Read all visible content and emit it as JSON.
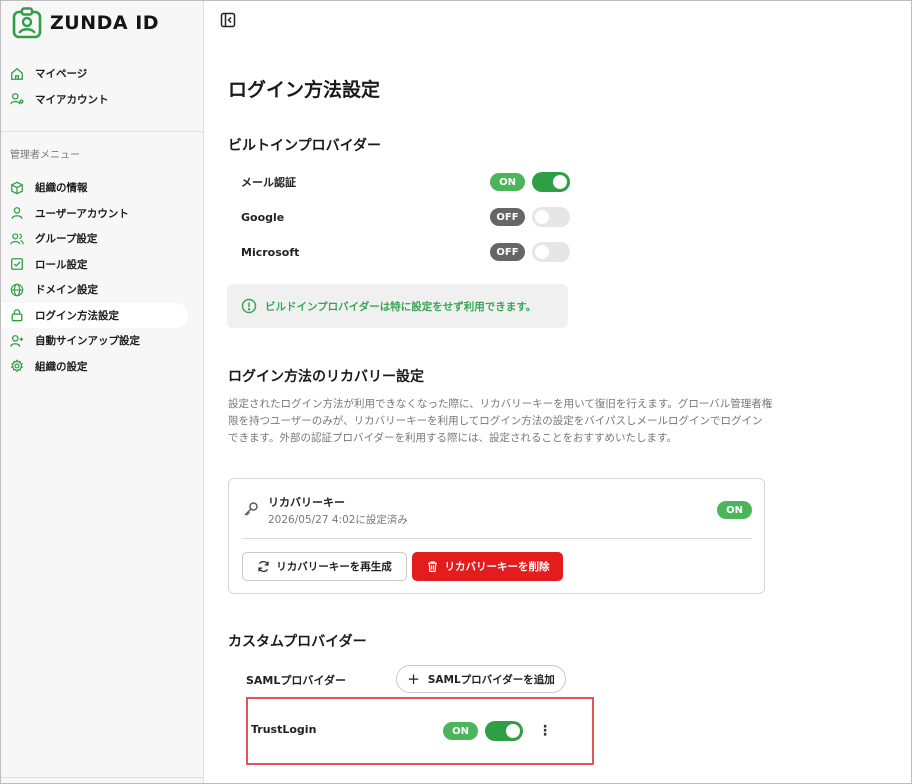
{
  "app": {
    "logo_text": "ZUNDA ID",
    "brand_color": "#2f9e44"
  },
  "sidebar": {
    "top_items": [
      {
        "label": "マイページ",
        "icon": "home-icon"
      },
      {
        "label": "マイアカウント",
        "icon": "user-settings-icon"
      }
    ],
    "section_label": "管理者メニュー",
    "admin_items": [
      {
        "label": "組織の情報",
        "icon": "box-icon"
      },
      {
        "label": "ユーザーアカウント",
        "icon": "user-icon"
      },
      {
        "label": "グループ設定",
        "icon": "users-icon"
      },
      {
        "label": "ロール設定",
        "icon": "checkbox-icon"
      },
      {
        "label": "ドメイン設定",
        "icon": "globe-icon"
      },
      {
        "label": "ログイン方法設定",
        "icon": "lock-icon",
        "active": true
      },
      {
        "label": "自動サインアップ設定",
        "icon": "user-plus-icon"
      },
      {
        "label": "組織の設定",
        "icon": "gear-icon"
      }
    ]
  },
  "main": {
    "title": "ログイン方法設定",
    "builtin": {
      "heading": "ビルトインプロバイダー",
      "providers": [
        {
          "name": "メール認証",
          "status": "ON",
          "enabled": true
        },
        {
          "name": "Google",
          "status": "OFF",
          "enabled": false
        },
        {
          "name": "Microsoft",
          "status": "OFF",
          "enabled": false
        }
      ],
      "info_text": "ビルドインプロバイダーは特に設定をせず利用できます。"
    },
    "recovery": {
      "heading": "ログイン方法のリカバリー設定",
      "description": "設定されたログイン方法が利用できなくなった際に、リカバリーキーを用いて復旧を行えます。グローバル管理者権限を持つユーザーのみが、リカバリーキーを利用してログイン方法の設定をバイパスしメールログインでログインできます。外部の認証プロバイダーを利用する際には、設定されることをおすすめいたします。",
      "key_title": "リカバリーキー",
      "key_subtitle": "2026/05/27 4:02に設定済み",
      "status": "ON",
      "regenerate_label": "リカバリーキーを再生成",
      "delete_label": "リカバリーキーを削除"
    },
    "custom": {
      "heading": "カスタムプロバイダー",
      "saml_label": "SAMLプロバイダー",
      "add_label": "SAMLプロバイダーを追加",
      "providers": [
        {
          "name": "TrustLogin",
          "status": "ON",
          "enabled": true
        }
      ]
    }
  }
}
